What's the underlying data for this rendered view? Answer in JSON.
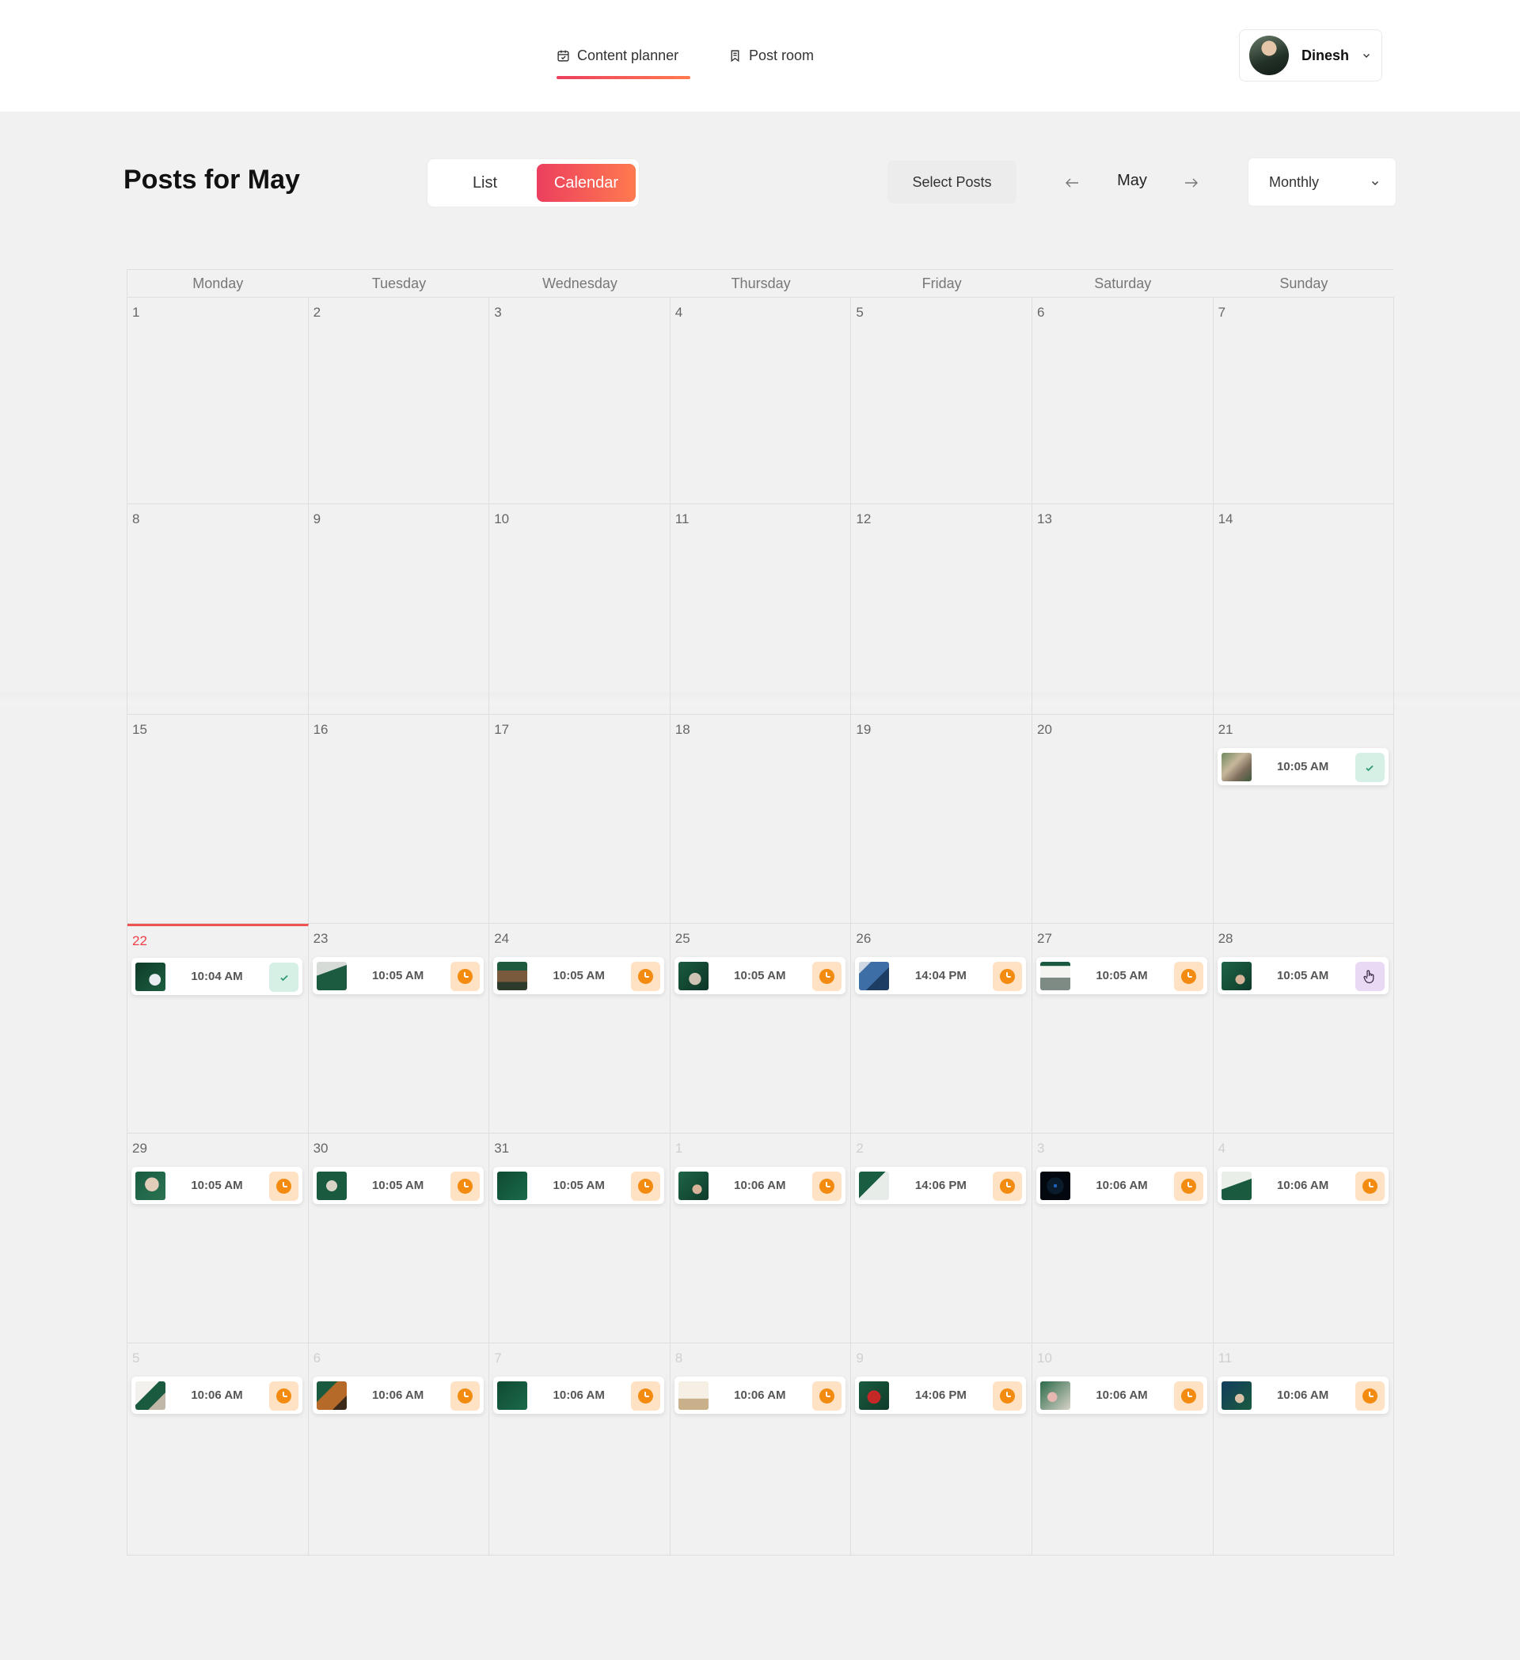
{
  "nav": {
    "items": [
      {
        "label": "Content planner",
        "icon": "calendar-check-icon"
      },
      {
        "label": "Post room",
        "icon": "bookmark-icon"
      }
    ],
    "active": 0
  },
  "user": {
    "name": "Dinesh"
  },
  "header": {
    "title": "Posts for May",
    "view_toggle": {
      "list": "List",
      "calendar": "Calendar",
      "active": "Calendar"
    },
    "select_posts": "Select Posts",
    "month": "May",
    "period": "Monthly"
  },
  "colors": {
    "accent_start": "#ec3f5e",
    "accent_end": "#ff7a4f",
    "scheduled_bg": "#ffe1c4",
    "scheduled_icon": "#f28b0f",
    "published_bg": "#d6f0e6",
    "review_bg": "#ead9f5",
    "today": "#ef3e49"
  },
  "calendar": {
    "weekdays": [
      "Monday",
      "Tuesday",
      "Wednesday",
      "Thursday",
      "Friday",
      "Saturday",
      "Sunday"
    ],
    "today": "22",
    "weeks": [
      [
        {
          "day": "1"
        },
        {
          "day": "2"
        },
        {
          "day": "3"
        },
        {
          "day": "4"
        },
        {
          "day": "5"
        },
        {
          "day": "6"
        },
        {
          "day": "7"
        }
      ],
      [
        {
          "day": "8"
        },
        {
          "day": "9"
        },
        {
          "day": "10"
        },
        {
          "day": "11"
        },
        {
          "day": "12"
        },
        {
          "day": "13"
        },
        {
          "day": "14"
        }
      ],
      [
        {
          "day": "15"
        },
        {
          "day": "16"
        },
        {
          "day": "17"
        },
        {
          "day": "18"
        },
        {
          "day": "19"
        },
        {
          "day": "20"
        },
        {
          "day": "21",
          "post": {
            "time": "10:05 AM",
            "status": "published",
            "thumb": "photo-people"
          }
        }
      ],
      [
        {
          "day": "22",
          "today": true,
          "post": {
            "time": "10:04 AM",
            "status": "published",
            "thumb": "green-device"
          }
        },
        {
          "day": "23",
          "post": {
            "time": "10:05 AM",
            "status": "scheduled",
            "thumb": "green-laptop"
          }
        },
        {
          "day": "24",
          "post": {
            "time": "10:05 AM",
            "status": "scheduled",
            "thumb": "green-interior"
          }
        },
        {
          "day": "25",
          "post": {
            "time": "10:05 AM",
            "status": "scheduled",
            "thumb": "green-people"
          }
        },
        {
          "day": "26",
          "post": {
            "time": "14:04 PM",
            "status": "scheduled",
            "thumb": "blue-building"
          }
        },
        {
          "day": "27",
          "post": {
            "time": "10:05 AM",
            "status": "scheduled",
            "thumb": "white-office"
          }
        },
        {
          "day": "28",
          "post": {
            "time": "10:05 AM",
            "status": "review",
            "thumb": "green-person"
          }
        }
      ],
      [
        {
          "day": "29",
          "post": {
            "time": "10:05 AM",
            "status": "scheduled",
            "thumb": "green-portrait"
          }
        },
        {
          "day": "30",
          "post": {
            "time": "10:05 AM",
            "status": "scheduled",
            "thumb": "green-circle"
          }
        },
        {
          "day": "31",
          "post": {
            "time": "10:05 AM",
            "status": "scheduled",
            "thumb": "green-text"
          }
        },
        {
          "day": "1",
          "other": true,
          "post": {
            "time": "10:06 AM",
            "status": "scheduled",
            "thumb": "green-person"
          }
        },
        {
          "day": "2",
          "other": true,
          "post": {
            "time": "14:06 PM",
            "status": "scheduled",
            "thumb": "green-doc"
          }
        },
        {
          "day": "3",
          "other": true,
          "post": {
            "time": "10:06 AM",
            "status": "scheduled",
            "thumb": "dark-circle"
          }
        },
        {
          "day": "4",
          "other": true,
          "post": {
            "time": "10:06 AM",
            "status": "scheduled",
            "thumb": "green-house"
          }
        }
      ],
      [
        {
          "day": "5",
          "other": true,
          "post": {
            "time": "10:06 AM",
            "status": "scheduled",
            "thumb": "green-hands"
          }
        },
        {
          "day": "6",
          "other": true,
          "post": {
            "time": "10:06 AM",
            "status": "scheduled",
            "thumb": "green-warm"
          }
        },
        {
          "day": "7",
          "other": true,
          "post": {
            "time": "10:06 AM",
            "status": "scheduled",
            "thumb": "green-text"
          }
        },
        {
          "day": "8",
          "other": true,
          "post": {
            "time": "10:06 AM",
            "status": "scheduled",
            "thumb": "cream-text"
          }
        },
        {
          "day": "9",
          "other": true,
          "post": {
            "time": "14:06 PM",
            "status": "scheduled",
            "thumb": "red-person"
          }
        },
        {
          "day": "10",
          "other": true,
          "post": {
            "time": "10:06 AM",
            "status": "scheduled",
            "thumb": "green-flowers"
          }
        },
        {
          "day": "11",
          "other": true,
          "post": {
            "time": "10:06 AM",
            "status": "scheduled",
            "thumb": "navy-person"
          }
        }
      ]
    ]
  }
}
